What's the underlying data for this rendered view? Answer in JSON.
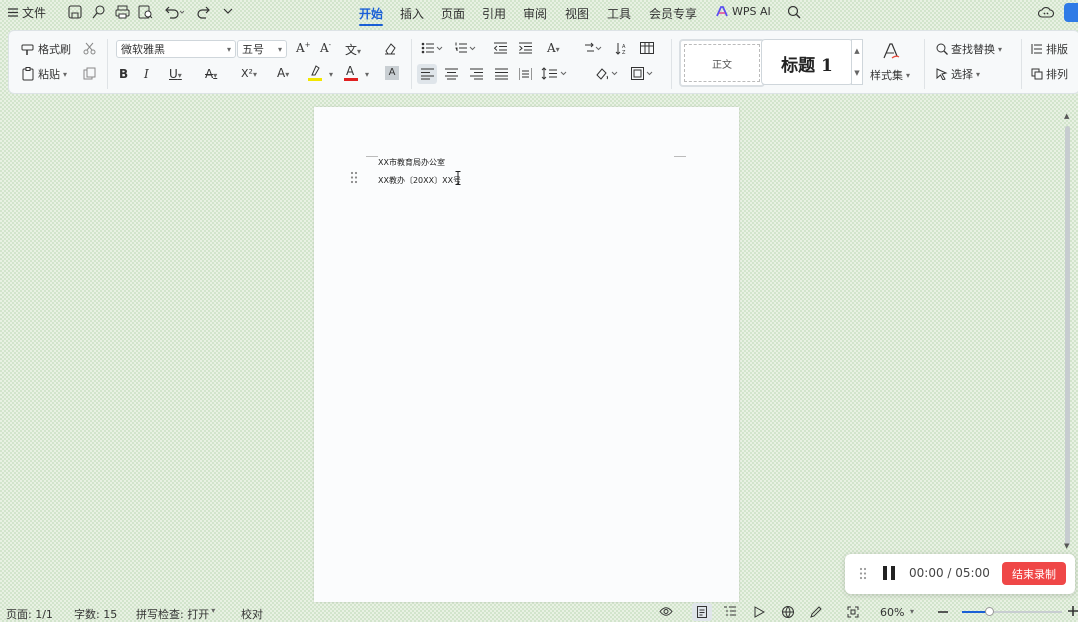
{
  "menubar": {
    "file_label": "文件",
    "tabs": [
      "开始",
      "插入",
      "页面",
      "引用",
      "审阅",
      "视图",
      "工具",
      "会员专享"
    ],
    "active_tab": "开始",
    "wps_ai_label": "WPS AI"
  },
  "ribbon": {
    "format_painter": "格式刷",
    "paste": "粘贴",
    "font_name": "微软雅黑",
    "font_size": "五号",
    "style_normal": "正文",
    "style_heading": "标题 1",
    "styles_set": "样式集",
    "find_replace": "查找替换",
    "select": "选择",
    "layout": "排版",
    "arrange": "排列"
  },
  "document": {
    "line1": "XX市教育局办公室",
    "line2": "XX教办〔20XX〕XX号"
  },
  "recorder": {
    "time": "00:00 / 05:00",
    "stop_label": "结束录制"
  },
  "statusbar": {
    "page": "页面: 1/1",
    "word_count": "字数: 15",
    "spell_check": "拼写检查: 打开",
    "proofread": "校对",
    "zoom": "60%"
  },
  "colors": {
    "accent": "#1a5fd6",
    "record_button": "#ef4747",
    "highlight_bar": "#f2e600",
    "font_color_bar": "#e02020"
  },
  "icons": [
    "menu-icon",
    "save-icon",
    "print-icon",
    "undo-icon",
    "redo-icon",
    "cloud-icon",
    "search-icon",
    "pause-icon",
    "drag-handle-icon",
    "eye-icon",
    "zoom-out-icon",
    "zoom-in-icon"
  ]
}
